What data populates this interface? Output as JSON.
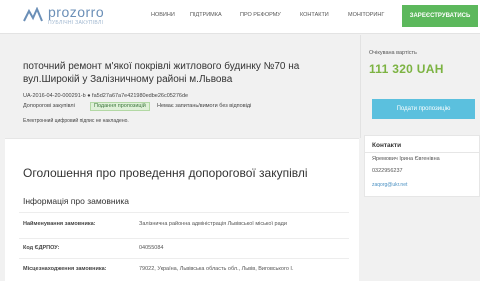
{
  "header": {
    "logo_name": "prozorro",
    "logo_sub": "публічні закупівлі",
    "nav": [
      "Новини",
      "Підтримка",
      "Про реформу",
      "Контакти",
      "Моніторинг"
    ],
    "register_label": "Зареєструватись"
  },
  "tender": {
    "title": "поточний ремонт м'якої покрівлі житлового будинку №70 на вул.Широкій у Залізничному районі м.Львова",
    "id": "UA-2016-04-20-000291-b ● fa5d27a67a7e421980edbe26c05276de",
    "procurement_label": "Допорогові закупівлі",
    "status_badge": "Подання пропозицій",
    "no_questions": "Немає запитань/вимоги без відповіді",
    "signature_note": "Електронний цифровий підпис не накладено.",
    "estimated_label": "Очікувана вартість",
    "estimated_value": "111 320 UAH",
    "submit_label": "Подати пропозицію"
  },
  "main": {
    "heading": "Оголошення про проведення допорогової закупівлі",
    "section_title": "Інформація про замовника",
    "rows": [
      {
        "key": "Найменування замовника:",
        "value": "Залізнична районна адміністрація Львівської міської ради"
      },
      {
        "key": "Код ЄДРПОУ:",
        "value": "04055084"
      },
      {
        "key": "Місцезнаходження замовника:",
        "value": "79022, Україна, Львівська область обл., Львів, Виговського І."
      }
    ]
  },
  "contacts": {
    "title": "Контакти",
    "name": "Яремович Ірина Євгенівна",
    "phone": "0322956237",
    "email": "zaqorg@ukr.net"
  },
  "colors": {
    "accent_green": "#5cb85c",
    "value_green": "#7cb342",
    "submit_blue": "#5bc0de"
  }
}
